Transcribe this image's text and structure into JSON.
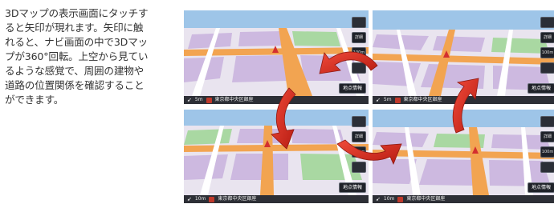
{
  "description_lines": [
    "3Dマップの表示画面にタッチす",
    "ると矢印が現れます。矢印に触",
    "れると、ナビ画面の中で3Dマッ",
    "プが360°回転。上空から見てい",
    "るような感覚で、周囲の建物や",
    "道路の位置関係を確認すること",
    "ができます。"
  ],
  "screens": [
    {
      "position": "top-left",
      "scale": "5m",
      "address": "東京都中央区銀座",
      "location_button": "地点情報",
      "side_buttons": [
        "",
        "詳細",
        "100m",
        ""
      ]
    },
    {
      "position": "top-right",
      "scale": "5m",
      "address": "東京都中央区銀座",
      "location_button": "地点情報",
      "side_buttons": [
        "",
        "詳細",
        "100m",
        ""
      ]
    },
    {
      "position": "bottom-left",
      "scale": "10m",
      "address": "東京都中央区銀座",
      "location_button": "地点情報",
      "side_buttons": [
        "",
        "詳細",
        "100m",
        ""
      ]
    },
    {
      "position": "bottom-right",
      "scale": "10m",
      "address": "東京都中央区銀座",
      "location_button": "地点情報",
      "side_buttons": [
        "",
        "詳細",
        "100m",
        ""
      ]
    }
  ],
  "colors": {
    "sky": "#9ec5e8",
    "ground": "#e9e4ef",
    "block": "#cdb9e0",
    "green_block": "#a9d8a2",
    "main_road": "#f2a451",
    "side_road": "#ffffff",
    "rotation_arrow": "#d7261e",
    "text": "#333333"
  },
  "icons": {
    "rotation_arrow": "curved-red-arrow",
    "current_position": "red-triangle-pointer",
    "compass": "north-arrow"
  }
}
